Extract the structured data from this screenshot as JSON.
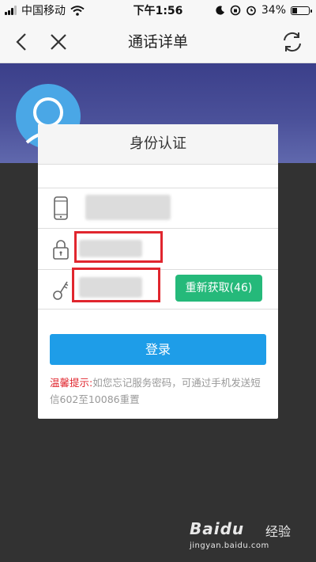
{
  "status_bar": {
    "carrier": "中国移动",
    "time": "下午1:56",
    "battery_percent": "34%",
    "battery_level": 0.34
  },
  "nav": {
    "title": "通话详单"
  },
  "card": {
    "title": "身份认证",
    "resend_button": "重新获取(46)",
    "login_button": "登录",
    "tip_label": "温馨提示:",
    "tip_text": "如您忘记服务密码，可通过手机发送短信602至10086重置"
  },
  "watermark": {
    "brand": "Baidu",
    "suffix": "经验",
    "url": "jingyan.baidu.com"
  },
  "colors": {
    "accent_blue": "#1e9de8",
    "resend_green": "#25b97a",
    "highlight_red": "#e0262e",
    "hero_purple": "#4a5099"
  }
}
